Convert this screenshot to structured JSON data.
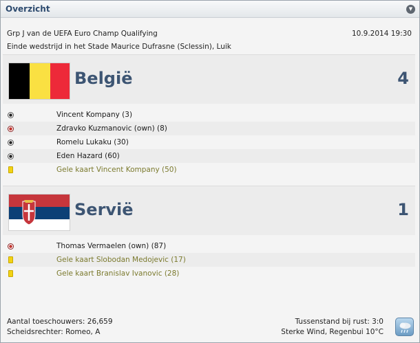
{
  "header": {
    "title": "Overzicht",
    "collapse_icon": "chevron-down-icon"
  },
  "match": {
    "competition": "Grp J van de UEFA Euro Champ Qualifying",
    "datetime": "10.9.2014 19:30",
    "venue": "Einde wedstrijd in het Stade Maurice Dufrasne (Sclessin), Luik"
  },
  "home": {
    "name": "België",
    "score": "4",
    "flag_colors": [
      "#000000",
      "#fae042",
      "#ed2939"
    ],
    "events": [
      {
        "icon": "ball-icon",
        "type": "goal",
        "text": "Vincent Kompany (3)"
      },
      {
        "icon": "own-goal-ball-icon",
        "type": "own",
        "text": "Zdravko Kuzmanovic (own) (8)"
      },
      {
        "icon": "ball-icon",
        "type": "goal",
        "text": "Romelu Lukaku (30)"
      },
      {
        "icon": "ball-icon",
        "type": "goal",
        "text": "Eden Hazard (60)"
      },
      {
        "icon": "yellow-card-icon",
        "type": "card",
        "text": "Gele kaart Vincent Kompany (50)"
      }
    ]
  },
  "away": {
    "name": "Servië",
    "score": "1",
    "flag_colors": [
      "#c6363c",
      "#0c4076",
      "#ffffff"
    ],
    "events": [
      {
        "icon": "own-goal-ball-icon",
        "type": "own",
        "text": "Thomas Vermaelen (own) (87)"
      },
      {
        "icon": "yellow-card-icon",
        "type": "card",
        "text": "Gele kaart Slobodan Medojevic (17)"
      },
      {
        "icon": "yellow-card-icon",
        "type": "card",
        "text": "Gele kaart Branislav Ivanovic (28)"
      }
    ]
  },
  "footer": {
    "attendance": "Aantal toeschouwers: 26,659",
    "referee": "Scheidsrechter: Romeo, A",
    "halftime": "Tussenstand bij rust: 3:0",
    "weather": "Sterke Wind, Regenbui 10°C",
    "weather_icon": "rain-cloud-icon"
  }
}
